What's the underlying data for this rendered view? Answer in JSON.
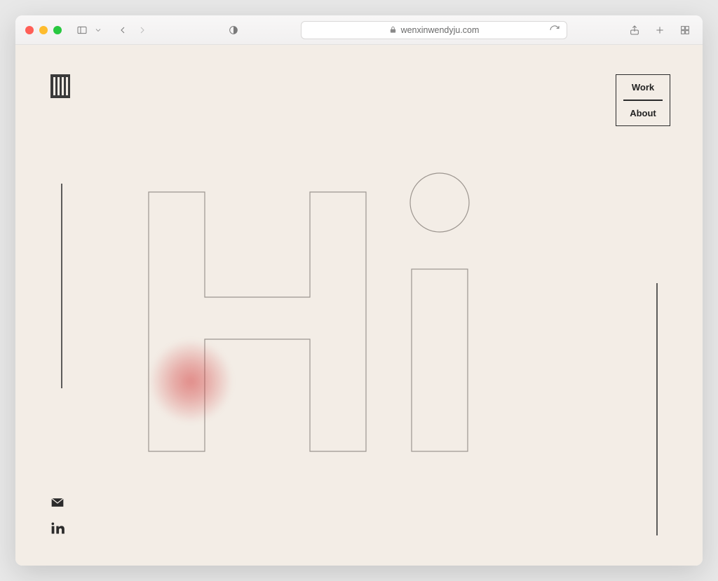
{
  "browser": {
    "url_display": "wenxinwendyju.com"
  },
  "nav": {
    "work": "Work",
    "about": "About"
  }
}
